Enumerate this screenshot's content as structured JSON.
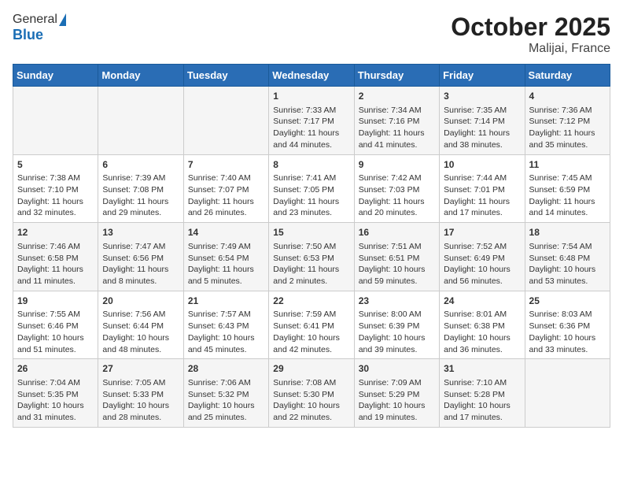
{
  "header": {
    "logo_line1": "General",
    "logo_line2": "Blue",
    "title": "October 2025",
    "subtitle": "Malijai, France"
  },
  "weekdays": [
    "Sunday",
    "Monday",
    "Tuesday",
    "Wednesday",
    "Thursday",
    "Friday",
    "Saturday"
  ],
  "weeks": [
    [
      {
        "day": "",
        "info": ""
      },
      {
        "day": "",
        "info": ""
      },
      {
        "day": "",
        "info": ""
      },
      {
        "day": "1",
        "info": "Sunrise: 7:33 AM\nSunset: 7:17 PM\nDaylight: 11 hours and 44 minutes."
      },
      {
        "day": "2",
        "info": "Sunrise: 7:34 AM\nSunset: 7:16 PM\nDaylight: 11 hours and 41 minutes."
      },
      {
        "day": "3",
        "info": "Sunrise: 7:35 AM\nSunset: 7:14 PM\nDaylight: 11 hours and 38 minutes."
      },
      {
        "day": "4",
        "info": "Sunrise: 7:36 AM\nSunset: 7:12 PM\nDaylight: 11 hours and 35 minutes."
      }
    ],
    [
      {
        "day": "5",
        "info": "Sunrise: 7:38 AM\nSunset: 7:10 PM\nDaylight: 11 hours and 32 minutes."
      },
      {
        "day": "6",
        "info": "Sunrise: 7:39 AM\nSunset: 7:08 PM\nDaylight: 11 hours and 29 minutes."
      },
      {
        "day": "7",
        "info": "Sunrise: 7:40 AM\nSunset: 7:07 PM\nDaylight: 11 hours and 26 minutes."
      },
      {
        "day": "8",
        "info": "Sunrise: 7:41 AM\nSunset: 7:05 PM\nDaylight: 11 hours and 23 minutes."
      },
      {
        "day": "9",
        "info": "Sunrise: 7:42 AM\nSunset: 7:03 PM\nDaylight: 11 hours and 20 minutes."
      },
      {
        "day": "10",
        "info": "Sunrise: 7:44 AM\nSunset: 7:01 PM\nDaylight: 11 hours and 17 minutes."
      },
      {
        "day": "11",
        "info": "Sunrise: 7:45 AM\nSunset: 6:59 PM\nDaylight: 11 hours and 14 minutes."
      }
    ],
    [
      {
        "day": "12",
        "info": "Sunrise: 7:46 AM\nSunset: 6:58 PM\nDaylight: 11 hours and 11 minutes."
      },
      {
        "day": "13",
        "info": "Sunrise: 7:47 AM\nSunset: 6:56 PM\nDaylight: 11 hours and 8 minutes."
      },
      {
        "day": "14",
        "info": "Sunrise: 7:49 AM\nSunset: 6:54 PM\nDaylight: 11 hours and 5 minutes."
      },
      {
        "day": "15",
        "info": "Sunrise: 7:50 AM\nSunset: 6:53 PM\nDaylight: 11 hours and 2 minutes."
      },
      {
        "day": "16",
        "info": "Sunrise: 7:51 AM\nSunset: 6:51 PM\nDaylight: 10 hours and 59 minutes."
      },
      {
        "day": "17",
        "info": "Sunrise: 7:52 AM\nSunset: 6:49 PM\nDaylight: 10 hours and 56 minutes."
      },
      {
        "day": "18",
        "info": "Sunrise: 7:54 AM\nSunset: 6:48 PM\nDaylight: 10 hours and 53 minutes."
      }
    ],
    [
      {
        "day": "19",
        "info": "Sunrise: 7:55 AM\nSunset: 6:46 PM\nDaylight: 10 hours and 51 minutes."
      },
      {
        "day": "20",
        "info": "Sunrise: 7:56 AM\nSunset: 6:44 PM\nDaylight: 10 hours and 48 minutes."
      },
      {
        "day": "21",
        "info": "Sunrise: 7:57 AM\nSunset: 6:43 PM\nDaylight: 10 hours and 45 minutes."
      },
      {
        "day": "22",
        "info": "Sunrise: 7:59 AM\nSunset: 6:41 PM\nDaylight: 10 hours and 42 minutes."
      },
      {
        "day": "23",
        "info": "Sunrise: 8:00 AM\nSunset: 6:39 PM\nDaylight: 10 hours and 39 minutes."
      },
      {
        "day": "24",
        "info": "Sunrise: 8:01 AM\nSunset: 6:38 PM\nDaylight: 10 hours and 36 minutes."
      },
      {
        "day": "25",
        "info": "Sunrise: 8:03 AM\nSunset: 6:36 PM\nDaylight: 10 hours and 33 minutes."
      }
    ],
    [
      {
        "day": "26",
        "info": "Sunrise: 7:04 AM\nSunset: 5:35 PM\nDaylight: 10 hours and 31 minutes."
      },
      {
        "day": "27",
        "info": "Sunrise: 7:05 AM\nSunset: 5:33 PM\nDaylight: 10 hours and 28 minutes."
      },
      {
        "day": "28",
        "info": "Sunrise: 7:06 AM\nSunset: 5:32 PM\nDaylight: 10 hours and 25 minutes."
      },
      {
        "day": "29",
        "info": "Sunrise: 7:08 AM\nSunset: 5:30 PM\nDaylight: 10 hours and 22 minutes."
      },
      {
        "day": "30",
        "info": "Sunrise: 7:09 AM\nSunset: 5:29 PM\nDaylight: 10 hours and 19 minutes."
      },
      {
        "day": "31",
        "info": "Sunrise: 7:10 AM\nSunset: 5:28 PM\nDaylight: 10 hours and 17 minutes."
      },
      {
        "day": "",
        "info": ""
      }
    ]
  ]
}
